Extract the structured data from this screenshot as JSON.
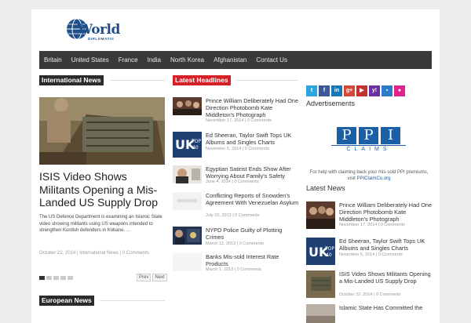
{
  "site": {
    "logo_word": "World",
    "logo_sub": "DIPLOMATIC"
  },
  "nav": [
    "Britain",
    "United States",
    "France",
    "India",
    "North Korea",
    "Afghanistan",
    "Contact Us"
  ],
  "international": {
    "title": "International News",
    "featured": {
      "headline": "ISIS Video Shows Militants Opening a Mis-Landed US Supply Drop",
      "excerpt": "The US Defence Department is examining an Islamic State video showing militants using US weapons intended to strengthen Kurdish defenders in Kobane. ...",
      "date": "October 22, 2014",
      "category": "International News",
      "comments": "0 Comments"
    },
    "pager": {
      "prev": "Prev",
      "next": "Next"
    }
  },
  "headlines": {
    "title": "Latest Headlines",
    "items": [
      {
        "title": "Prince William Deliberately Had One Direction Photobomb Kate Middleton's Photograph",
        "date": "November 17, 2014",
        "comments": "0 Comments"
      },
      {
        "title": "Ed Sheeran, Taylor Swift Tops UK Albums and Singles Charts",
        "date": "November 5, 2014",
        "comments": "0 Comments"
      },
      {
        "title": "Egyptian Satirist Ends Show After Worrying About Family's Safety",
        "date": "June 4, 2014",
        "comments": "0 Comments"
      },
      {
        "title": "Conflicting Reports of Snowden's Agreement With Venezuelan Asylum",
        "date": "July 10, 2013",
        "comments": "0 Comments"
      },
      {
        "title": "NYPD Police Guilty of Plotting Crimes",
        "date": "March 12, 2013",
        "comments": "0 Comments"
      },
      {
        "title": "Banks Mis-sold Interest Rate Products",
        "date": "March 1, 2013",
        "comments": "0 Comments"
      }
    ]
  },
  "european": {
    "title": "European News"
  },
  "social_icons": [
    "twitter-icon",
    "facebook-icon",
    "linkedin-icon",
    "google-plus-icon",
    "youtube-icon",
    "yahoo-icon",
    "delicious-icon",
    "flickr-icon"
  ],
  "ads": {
    "title": "Advertisements",
    "brand_letters": [
      "P",
      "P",
      "I"
    ],
    "brand_word": "CLAIMS",
    "text": "For help with claiming back your mis-sold PPI premiums, visit",
    "link": "PPIClaimCo.org"
  },
  "latest": {
    "title": "Latest News",
    "items": [
      {
        "title": "Prince William Deliberately Had One Direction Photobomb Kate Middleton's Photograph",
        "date": "November 17, 2014",
        "comments": "0 Comments"
      },
      {
        "title": "Ed Sheeran, Taylor Swift Tops UK Albums and Singles Charts",
        "date": "November 5, 2014",
        "comments": "0 Comments"
      },
      {
        "title": "ISIS Video Shows Militants Opening a Mis-Landed US Supply Drop",
        "date": "October 22, 2014",
        "comments": "0 Comments"
      },
      {
        "title": "Islamic State Has Committed the"
      }
    ]
  },
  "colors": {
    "accent_red": "#d62027",
    "nav_bg": "#3a3a3a",
    "brand_blue": "#1b5fa8"
  }
}
